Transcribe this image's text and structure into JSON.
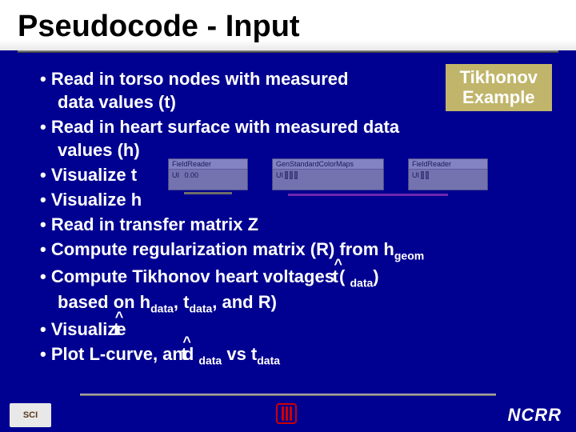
{
  "title": "Pseudocode - Input",
  "badge": {
    "line1": "Tikhonov",
    "line2": "Example"
  },
  "bullets": {
    "b1a": "Read in torso nodes with measured",
    "b1b": "data values (t)",
    "b2a": "Read in heart surface with measured data",
    "b2b": "values (h)",
    "b3": "Visualize t",
    "b4": "Visualize h",
    "b5": "Read in transfer matrix Z",
    "b6a": "Compute regularization matrix (R) from h",
    "b6sub": "geom",
    "b7a": "Compute Tikhonov heart voltages ( ",
    "b7t": "t",
    "b7sub": "data",
    "b7b": ")",
    "b7c": "based on h",
    "b7csub": "data",
    "b7d": ", t",
    "b7dsub": "data",
    "b7e": ", and R)",
    "b8a": "Visualize ",
    "b8t": "t",
    "b9a": "Plot L-curve, and  ",
    "b9t": "t",
    "b9sub": "data",
    "b9b": " vs t",
    "b9bsub": "data"
  },
  "panels": {
    "p1": "FieldReader",
    "p2": "GenStandardColorMaps",
    "p3": "FieldReader",
    "ui": "UI",
    "num": "0.00"
  },
  "footer": {
    "sci": "SCI",
    "ncrr": "NCRR"
  }
}
